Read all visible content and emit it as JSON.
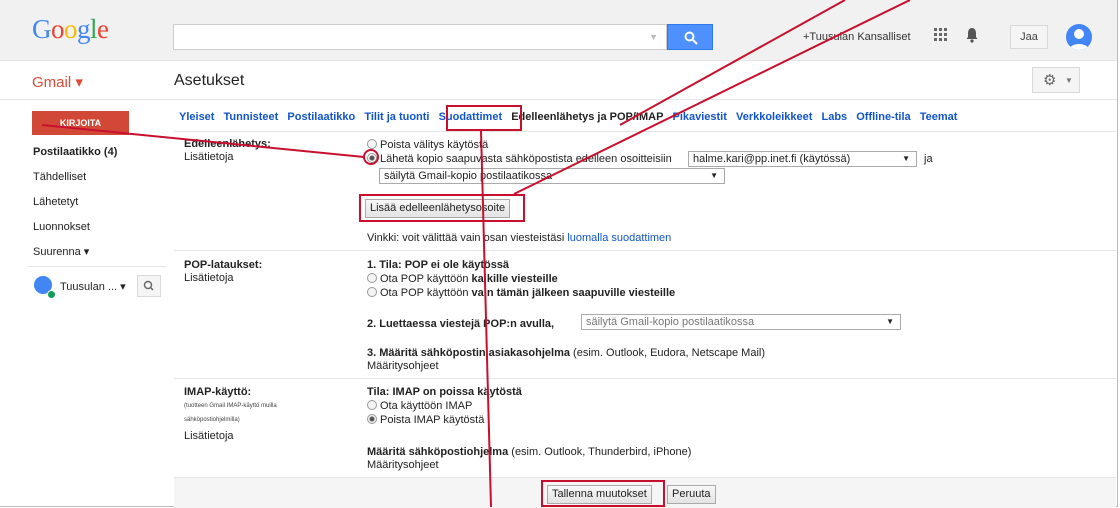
{
  "header": {
    "logo_letters": [
      "G",
      "o",
      "o",
      "g",
      "l",
      "e"
    ],
    "plus_link": "+Tuusulan Kansalliset",
    "share_label": "Jaa"
  },
  "subbar": {
    "gmail_label": "Gmail ▾",
    "title": "Asetukset"
  },
  "sidebar": {
    "compose": "KIRJOITA",
    "items": [
      {
        "label": "Postilaatikko (4)",
        "bold": true
      },
      {
        "label": "Tähdelliset"
      },
      {
        "label": "Lähetetyt"
      },
      {
        "label": "Luonnokset"
      },
      {
        "label": "Suurenna ▾"
      }
    ],
    "hangout_name": "Tuusulan ... ▾"
  },
  "tabs": [
    "Yleiset",
    "Tunnisteet",
    "Postilaatikko",
    "Tilit ja tuonti",
    "Suodattimet",
    "Edelleenlähetys ja POP/IMAP",
    "Pikaviestit",
    "Verkkoleikkeet",
    "Labs",
    "Offline-tila",
    "Teemat"
  ],
  "forwarding": {
    "label": "Edelleenlähetys:",
    "learn_more": "Lisätietoja",
    "opt_off": "Poista välitys käytöstä",
    "opt_on": "Lähetä kopio saapuvasta sähköpostista edelleen osoitteisiin",
    "address_select": "halme.kari@pp.inet.fi (käytössä)",
    "and": "ja",
    "keep_select": "säilytä Gmail-kopio postilaatikossa",
    "add_button": "Lisää edelleenlähetysosoite",
    "tip_prefix": "Vinkki: voit välittää vain osan viesteistäsi",
    "tip_link": "luomalla suodattimen"
  },
  "pop": {
    "label": "POP-lataukset:",
    "learn_more": "Lisätietoja",
    "status": "1. Tila: POP ei ole käytössä",
    "opt_all_prefix": "Ota POP käyttöön",
    "opt_all_bold": "kaikille viesteille",
    "opt_new_prefix": "Ota POP käyttöön",
    "opt_new_bold": "vain tämän jälkeen saapuville viesteille",
    "when_label": "2. Luettaessa viestejä POP:n avulla,",
    "when_select": "säilytä Gmail-kopio postilaatikossa",
    "client_bold": "3. Määritä sähköpostin asiakasohjelma",
    "client_rest": "(esim. Outlook, Eudora, Netscape Mail)",
    "instructions": "Määritysohjeet"
  },
  "imap": {
    "label": "IMAP-käyttö:",
    "note_1": "(tuotteen Gmail IMAP-käyttö muilla",
    "note_2": "sähköpostiohjelmilla)",
    "learn_more": "Lisätietoja",
    "status": "Tila: IMAP on poissa käytöstä",
    "opt_on": "Ota käyttöön IMAP",
    "opt_off": "Poista IMAP käytöstä",
    "client_bold": "Määritä sähköpostiohjelma",
    "client_rest": "(esim. Outlook, Thunderbird, iPhone)",
    "instructions": "Määritysohjeet"
  },
  "footer": {
    "save": "Tallenna muutokset",
    "cancel": "Peruuta"
  },
  "colors": {
    "accent": "#4d90fe",
    "compose": "#d14836",
    "annotation": "#c8102e",
    "link": "#1155cc"
  }
}
